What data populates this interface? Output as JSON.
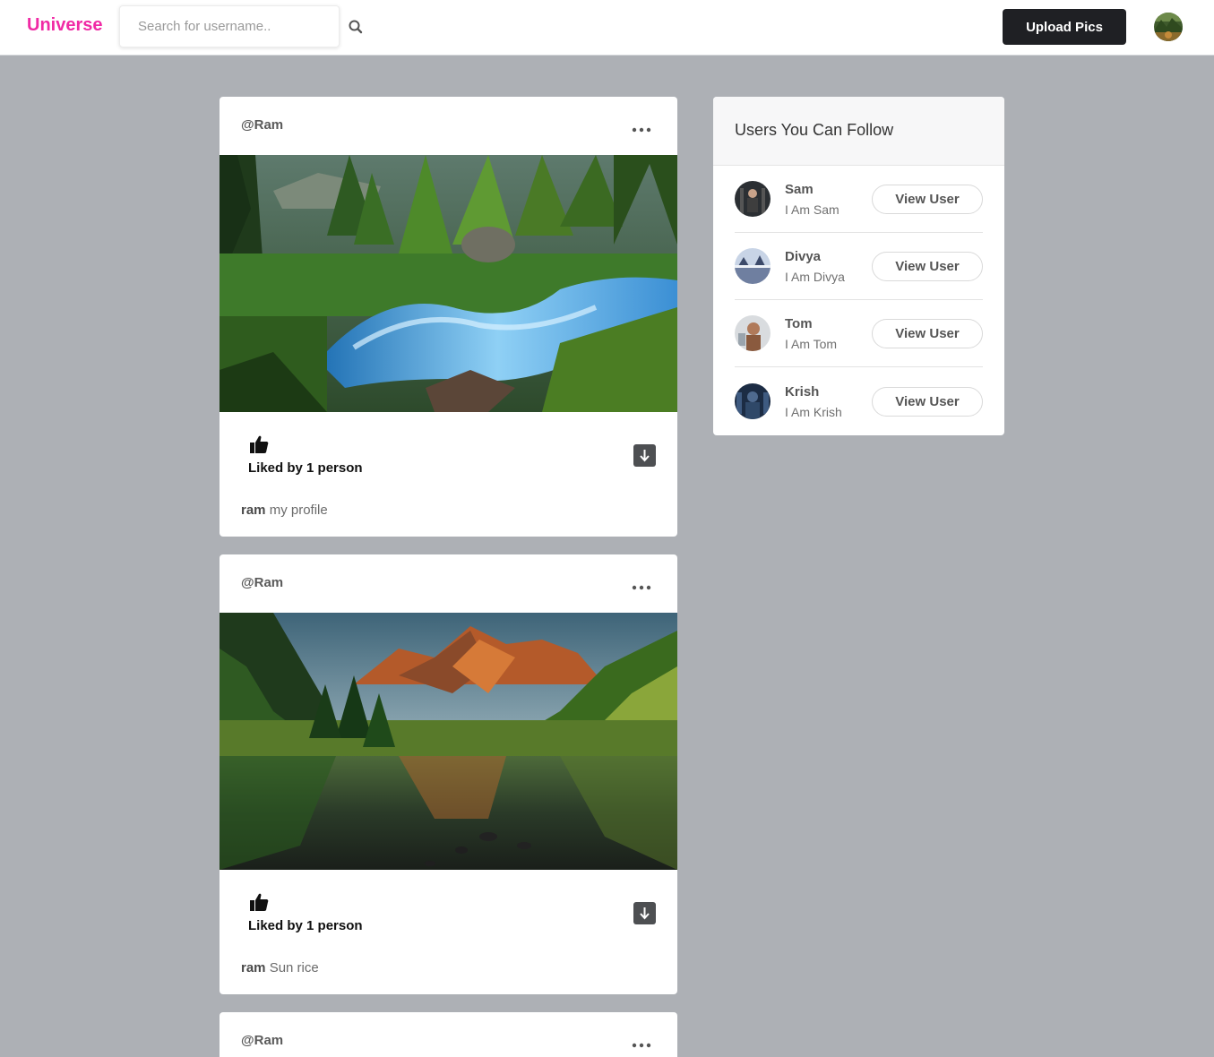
{
  "header": {
    "brand": "Universe",
    "search_placeholder": "Search for username..",
    "upload_label": "Upload Pics"
  },
  "posts": [
    {
      "username": "@Ram",
      "liked_by": "Liked by 1 person",
      "caption_user": "ram",
      "caption_text": "my profile",
      "image": "forest-stream"
    },
    {
      "username": "@Ram",
      "liked_by": "Liked by 1 person",
      "caption_user": "ram",
      "caption_text": "Sun rice",
      "image": "mountain-lake"
    },
    {
      "username": "@Ram"
    }
  ],
  "sidebar": {
    "title": "Users You Can Follow",
    "users": [
      {
        "name": "Sam",
        "bio": "I Am Sam",
        "button": "View User"
      },
      {
        "name": "Divya",
        "bio": "I Am Divya",
        "button": "View User"
      },
      {
        "name": "Tom",
        "bio": "I Am Tom",
        "button": "View User"
      },
      {
        "name": "Krish",
        "bio": "I Am Krish",
        "button": "View User"
      }
    ]
  },
  "colors": {
    "brand": "#f02aa5",
    "background": "#adb0b5",
    "button_dark": "#1f2024"
  }
}
